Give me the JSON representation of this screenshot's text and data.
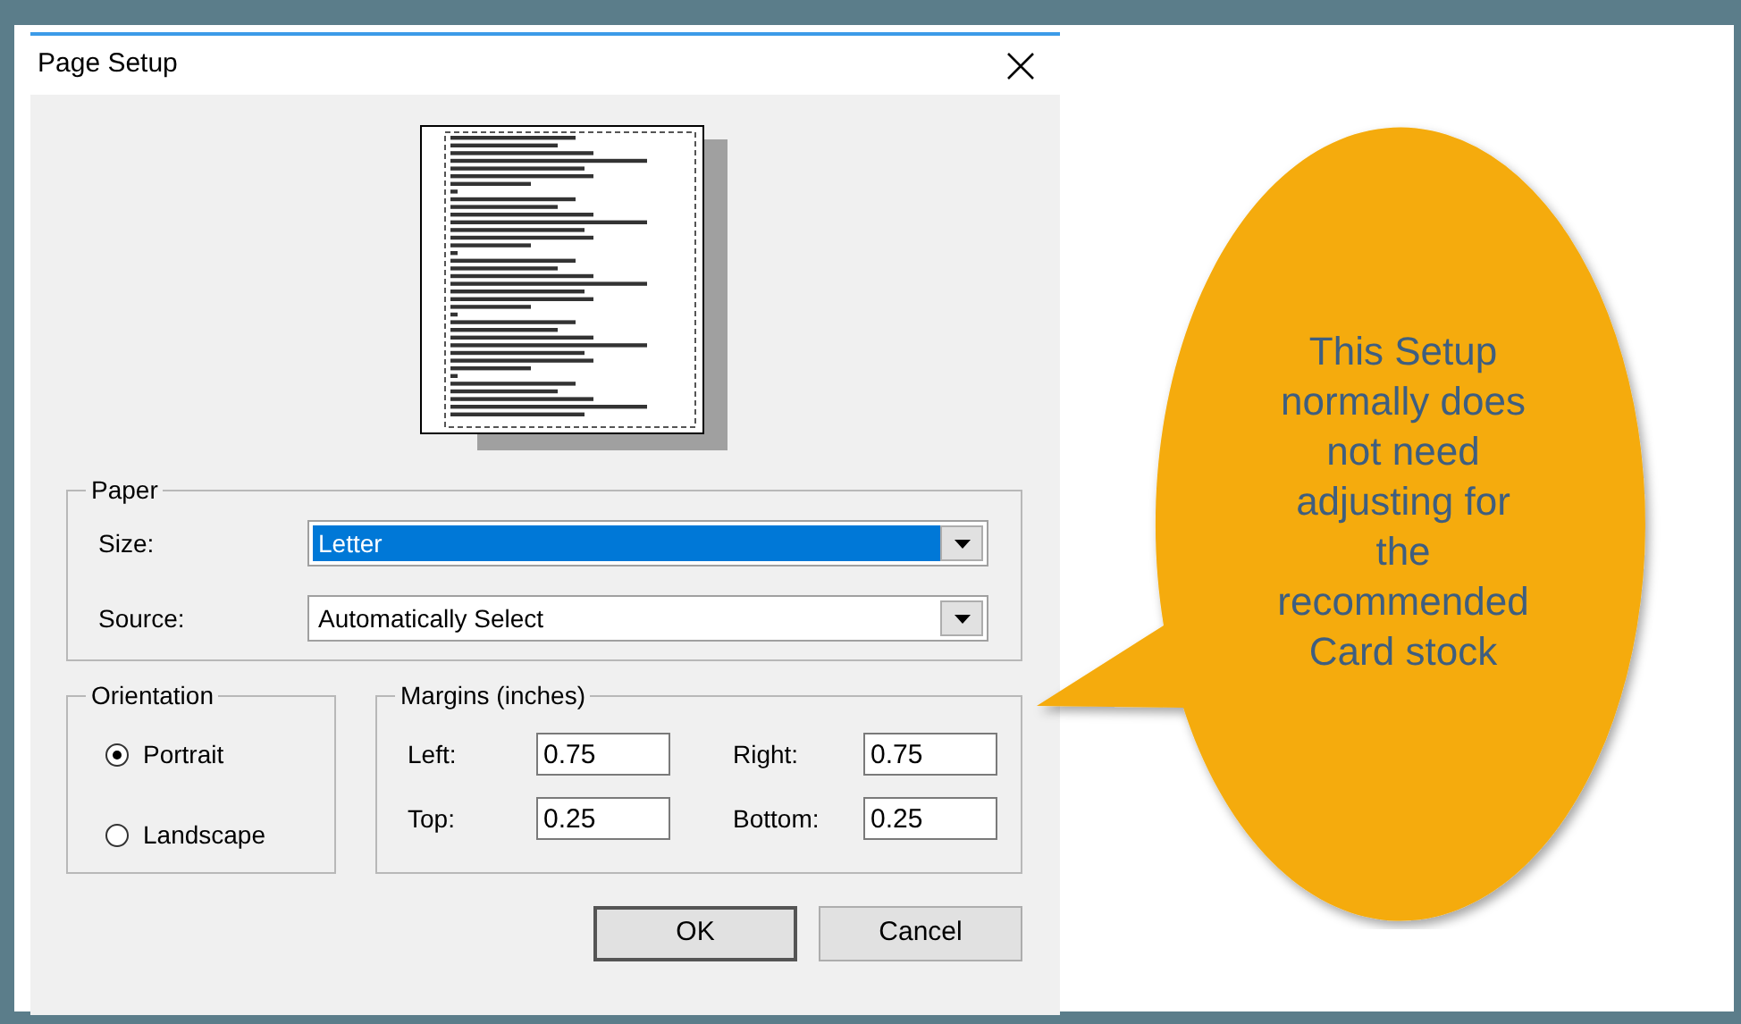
{
  "dialog": {
    "title": "Page Setup",
    "paper": {
      "legend": "Paper",
      "fields": [
        {
          "label": "Size:",
          "value": "Letter",
          "selected": true
        },
        {
          "label": "Source:",
          "value": "Automatically Select",
          "selected": false
        }
      ]
    },
    "orientation": {
      "legend": "Orientation",
      "options": [
        {
          "label": "Portrait",
          "selected": true
        },
        {
          "label": "Landscape",
          "selected": false
        }
      ]
    },
    "margins": {
      "legend": "Margins (inches)",
      "fields": [
        {
          "label": "Left:",
          "value": "0.75"
        },
        {
          "label": "Right:",
          "value": "0.75"
        },
        {
          "label": "Top:",
          "value": "0.25"
        },
        {
          "label": "Bottom:",
          "value": "0.25"
        }
      ]
    },
    "buttons": [
      {
        "label": "OK",
        "default": true
      },
      {
        "label": "Cancel",
        "default": false
      }
    ]
  },
  "callout": {
    "text": "This Setup\nnormally does\nnot need\nadjusting for\nthe\nrecommended\nCard stock"
  }
}
